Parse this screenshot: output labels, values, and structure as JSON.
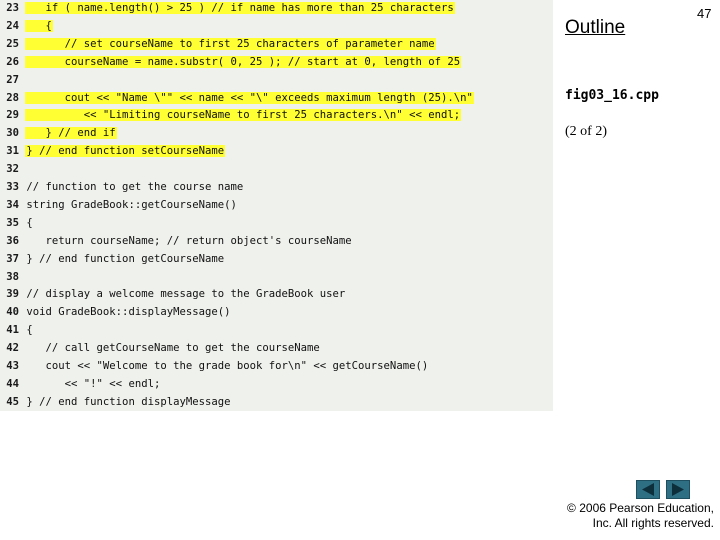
{
  "header": {
    "outline_label": "Outline",
    "page_number": "47"
  },
  "sidebar": {
    "file_name": "fig03_16.cpp",
    "part_label": "(2 of 2)"
  },
  "code": {
    "lines": [
      {
        "num": "23",
        "text": "   if ( name.length() > 25 ) // if name has more than 25 characters",
        "highlight": true
      },
      {
        "num": "24",
        "text": "   {",
        "highlight": true
      },
      {
        "num": "25",
        "text": "      // set courseName to first 25 characters of parameter name",
        "highlight": true
      },
      {
        "num": "26",
        "text": "      courseName = name.substr( 0, 25 ); // start at 0, length of 25",
        "highlight": true
      },
      {
        "num": "27",
        "text": "",
        "highlight": false
      },
      {
        "num": "28",
        "text": "      cout << \"Name \\\"\" << name << \"\\\" exceeds maximum length (25).\\n\"",
        "highlight": true
      },
      {
        "num": "29",
        "text": "         << \"Limiting courseName to first 25 characters.\\n\" << endl;",
        "highlight": true
      },
      {
        "num": "30",
        "text": "   } // end if",
        "highlight": true
      },
      {
        "num": "31",
        "text": "} // end function setCourseName",
        "highlight": true
      },
      {
        "num": "32",
        "text": "",
        "highlight": false
      },
      {
        "num": "33",
        "text": "// function to get the course name",
        "highlight": false
      },
      {
        "num": "34",
        "text": "string GradeBook::getCourseName()",
        "highlight": false
      },
      {
        "num": "35",
        "text": "{",
        "highlight": false
      },
      {
        "num": "36",
        "text": "   return courseName; // return object's courseName",
        "highlight": false
      },
      {
        "num": "37",
        "text": "} // end function getCourseName",
        "highlight": false
      },
      {
        "num": "38",
        "text": "",
        "highlight": false
      },
      {
        "num": "39",
        "text": "// display a welcome message to the GradeBook user",
        "highlight": false
      },
      {
        "num": "40",
        "text": "void GradeBook::displayMessage()",
        "highlight": false
      },
      {
        "num": "41",
        "text": "{",
        "highlight": false
      },
      {
        "num": "42",
        "text": "   // call getCourseName to get the courseName",
        "highlight": false
      },
      {
        "num": "43",
        "text": "   cout << \"Welcome to the grade book for\\n\" << getCourseName()",
        "highlight": false
      },
      {
        "num": "44",
        "text": "      << \"!\" << endl;",
        "highlight": false
      },
      {
        "num": "45",
        "text": "} // end function displayMessage",
        "highlight": false
      }
    ]
  },
  "nav": {
    "prev_icon": "triangle-left-icon",
    "next_icon": "triangle-right-icon"
  },
  "footer": {
    "copyright_line1": "© 2006 Pearson Education,",
    "copyright_line2": "Inc.  All rights reserved."
  },
  "colors": {
    "highlight": "#ffff33",
    "code_background": "#eef1ec",
    "nav_button": "#2f6f84"
  }
}
